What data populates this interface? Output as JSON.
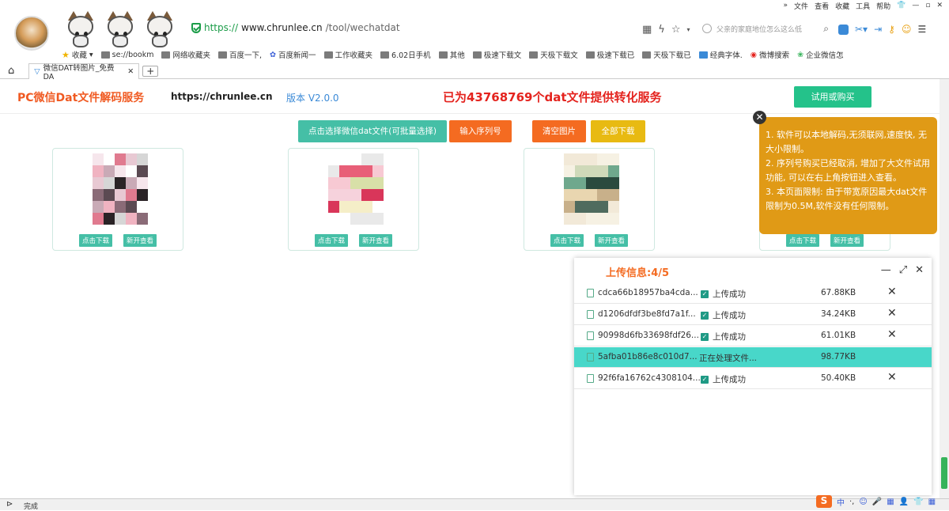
{
  "browser": {
    "menu": [
      "»",
      "文件",
      "查看",
      "收藏",
      "工具",
      "帮助"
    ],
    "window_controls": [
      "—",
      "▫",
      "✕"
    ],
    "url_https": "https://",
    "url_host": "www.chrunlee.cn",
    "url_path": "/tool/wechatdat",
    "search_placeholder": "父亲的家庭地位怎么这么低",
    "bookmarks": [
      "收藏",
      "se://bookm",
      "网络收藏夹",
      "百度一下,",
      "百度新闻一",
      "工作收藏夹",
      "6.02日手机",
      "其他",
      "极速下载文",
      "天极下载文",
      "极速下载已",
      "天极下载已",
      "经典字体.",
      "微博搜索",
      "企业微信怎"
    ],
    "tab_title": "微信DAT转图片_免费DA",
    "status_text": "完成"
  },
  "page": {
    "brand": "PC微信Dat文件解码服务",
    "site": "https://chrunlee.cn",
    "version": "版本 V2.0.0",
    "served": "已为43768769个dat文件提供转化服务",
    "try_buy": "试用或购买",
    "buttons": {
      "select": "点击选择微信dat文件(可批量选择)",
      "serial": "输入序列号",
      "clear": "清空图片",
      "download_all": "全部下载"
    },
    "card_download": "点击下载",
    "card_view": "新开查看",
    "tip": [
      "1. 软件可以本地解码,无须联网,速度快, 无大小限制。",
      "2. 序列号购买已经取消, 增加了大文件试用功能, 可以在右上角按钮进入查看。",
      "3. 本页面限制: 由于带宽原因最大dat文件限制为0.5M,软件没有任何限制。"
    ]
  },
  "upload": {
    "title": "上传信息:4/5",
    "rows": [
      {
        "name": "cdca66b18957ba4cda...",
        "status": "上传成功",
        "size": "67.88KB",
        "done": true
      },
      {
        "name": "d1206dfdf3be8fd7a1f...",
        "status": "上传成功",
        "size": "34.24KB",
        "done": true
      },
      {
        "name": "90998d6fb33698fdf26...",
        "status": "上传成功",
        "size": "61.01KB",
        "done": true
      },
      {
        "name": "5afba01b86e8c010d7...",
        "status": "正在处理文件...",
        "size": "98.77KB",
        "done": false
      },
      {
        "name": "92f6fa16762c4308104...",
        "status": "上传成功",
        "size": "50.40KB",
        "done": true
      }
    ]
  },
  "colors": {
    "accent_teal": "#45bfa6",
    "accent_orange": "#f46b21",
    "tip_bg": "#e09a16",
    "active_row": "#48d7c9"
  },
  "ime": [
    "中",
    "·,",
    "☺",
    "🎤",
    "▦",
    "👤",
    "👕",
    "▦"
  ]
}
